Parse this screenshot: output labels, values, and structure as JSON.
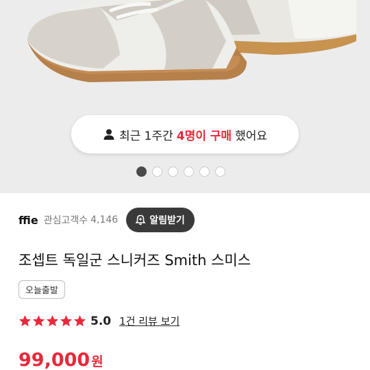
{
  "toast": {
    "prefix": "최근 1주간",
    "highlight": "4명이 구매",
    "suffix": "했어요"
  },
  "carousel": {
    "count": 6,
    "active_index": 0
  },
  "shop": {
    "name": "ffie",
    "followers_label": "관심고객수",
    "followers_count": "4,146",
    "alarm_label": "알림받기"
  },
  "product": {
    "title": "조셉트 독일군 스니커즈 Smith 스미스",
    "badge": "오늘출발"
  },
  "rating": {
    "stars": 5,
    "value": "5.0",
    "review_link": "1건 리뷰 보기"
  },
  "price": {
    "amount": "99,000",
    "currency": "원"
  },
  "colors": {
    "accent": "#e8293a",
    "button_dark": "#3a3a3a",
    "hero_bg": "#ececec"
  }
}
